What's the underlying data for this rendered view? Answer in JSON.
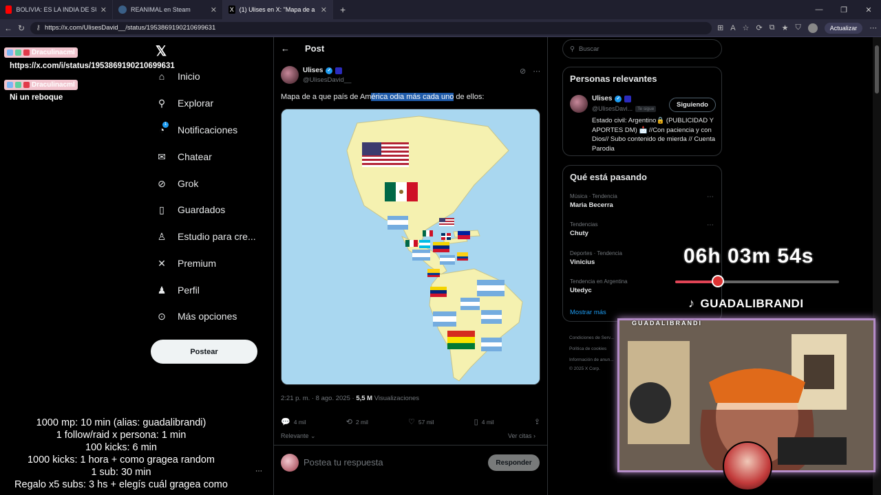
{
  "browser": {
    "tabs": [
      {
        "label": "BOLIVIA: ES LA INDIA DE SUDAMÉ",
        "fav_color": "#ff0000"
      },
      {
        "label": "REANIMAL en Steam",
        "fav_color": "#1b2838"
      },
      {
        "label": "(1) Ulises en X: \"Mapa de a que pa",
        "fav_color": "#000000"
      }
    ],
    "url": "https://x.com/UlisesDavid__/status/1953869190210699631",
    "update_label": "Actualizar"
  },
  "nav": {
    "items": [
      {
        "label": "Inicio",
        "icon": "home-icon",
        "glyph": "⌂"
      },
      {
        "label": "Explorar",
        "icon": "search-icon",
        "glyph": "⚲"
      },
      {
        "label": "Notificaciones",
        "icon": "bell-icon",
        "glyph": "♫"
      },
      {
        "label": "Chatear",
        "icon": "mail-icon",
        "glyph": "✉"
      },
      {
        "label": "Grok",
        "icon": "grok-icon",
        "glyph": "⊘"
      },
      {
        "label": "Guardados",
        "icon": "bookmark-icon",
        "glyph": "▯"
      },
      {
        "label": "Estudio para cre...",
        "icon": "studio-icon",
        "glyph": "♙"
      },
      {
        "label": "Premium",
        "icon": "x-premium-icon",
        "glyph": "✕"
      },
      {
        "label": "Perfil",
        "icon": "profile-icon",
        "glyph": "♟"
      },
      {
        "label": "Más opciones",
        "icon": "more-options-icon",
        "glyph": "⋯"
      }
    ],
    "notif_count": "1",
    "post_button": "Postear"
  },
  "post": {
    "header": "Post",
    "author_name": "Ulises",
    "author_handle": "@UlisesDavid__",
    "text_before": "Mapa de a que país de Am",
    "text_highlight": "érica odia más cada uno",
    "text_after": " de ellos:",
    "time": "2:21 p. m. · 8 ago. 2025 · ",
    "views": "5,5 M",
    "views_label": " Visualizaciones",
    "replies": "4 mil",
    "reposts": "2 mil",
    "likes": "57 mil",
    "bookmarks": "4 mil",
    "relevance": "Relevante",
    "quotes": "Ver citas",
    "reply_placeholder": "Postea tu respuesta",
    "reply_button": "Responder"
  },
  "sidebar": {
    "search_placeholder": "Buscar",
    "relevant_title": "Personas relevantes",
    "relevant_name": "Ulises",
    "relevant_handle": "@UlisesDavi...",
    "follows_you": "Te sigue",
    "follow_state": "Siguiendo",
    "bio": "Estado civil: Argentino🔒 (PUBLICIDAD Y APORTES DM) 📩 //Con paciencia y con Dios// Subo contenido de mierda // Cuenta Parodia",
    "trending_title": "Qué está pasando",
    "trends": [
      {
        "context": "Música · Tendencia",
        "name": "Maria Becerra"
      },
      {
        "context": "Tendencias",
        "name": "Chuty"
      },
      {
        "context": "Deportes · Tendencia",
        "name": "Vinicius"
      },
      {
        "context": "Tendencia en Argentina",
        "name": "Utedyc"
      }
    ],
    "show_more": "Mostrar más",
    "footer": [
      "Condiciones de Serv...",
      "Política de cookies",
      "Información de anun...",
      "© 2025 X Corp."
    ]
  },
  "overlay": {
    "chat": [
      {
        "user": "Draculinacml",
        "message": "https://x.com/i/status/1953869190210699631"
      },
      {
        "user": "Draculinacml",
        "message": "Ni un reboque"
      }
    ],
    "rules": [
      "1000 mp: 10 min (alias: guadalibrandi)",
      "1 follow/raid x persona: 1 min",
      "100 kicks: 6 min",
      "1000 kicks: 1 hora + como gragea random",
      "1 sub: 30 min",
      "Regalo x5 subs: 3 hs + elegís cuál gragea como"
    ],
    "timer": "06h 03m 54s",
    "timer_progress": 0.26,
    "tiktok_handle": "GUADALIBRANDI",
    "cam_label": "GUADALIBRANDI",
    "cam_frame_color": "#b48cc8"
  }
}
